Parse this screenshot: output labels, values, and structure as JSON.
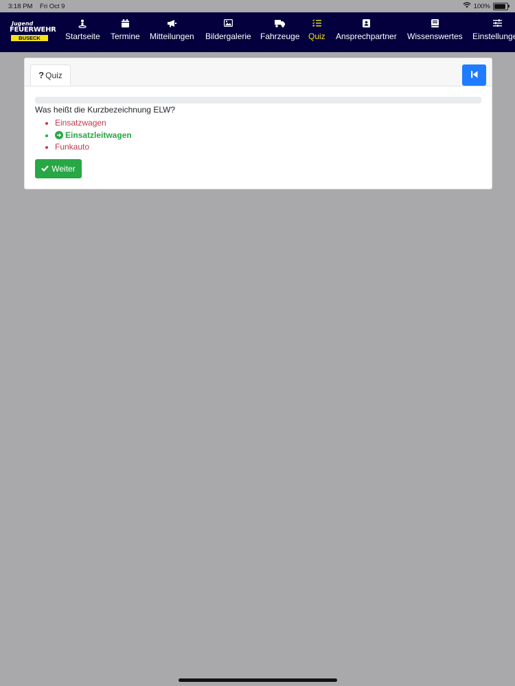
{
  "status_bar": {
    "time": "3:18 PM",
    "date": "Fri Oct 9",
    "battery": "100%",
    "battery_level": 1.0
  },
  "logo": {
    "line1": "Jugend",
    "line2": "FEUERWEHR",
    "line3": "BUSECK"
  },
  "nav": {
    "items": [
      {
        "label": "Startseite",
        "icon": "person-icon"
      },
      {
        "label": "Termine",
        "icon": "calendar-icon"
      },
      {
        "label": "Mitteilungen",
        "icon": "megaphone-icon"
      },
      {
        "label": "Bildergalerie",
        "icon": "image-icon"
      },
      {
        "label": "Fahrzeuge",
        "icon": "truck-icon"
      },
      {
        "label": "Quiz",
        "icon": "list-check-icon",
        "active": true
      },
      {
        "label": "Ansprechpartner",
        "icon": "contact-icon"
      },
      {
        "label": "Wissenswertes",
        "icon": "book-icon"
      },
      {
        "label": "Einstellungen",
        "icon": "sliders-icon"
      }
    ],
    "active_color": "#f4e11a",
    "background": "#03003d"
  },
  "quiz": {
    "tab_label": "Quiz",
    "progress": 0,
    "question": "Was heißt die Kurzbezeichnung ELW?",
    "answers": [
      {
        "label": "Einsatzwagen",
        "correct": false
      },
      {
        "label": "Einsatzleitwagen",
        "correct": true
      },
      {
        "label": "Funkauto",
        "correct": false
      }
    ],
    "next_label": "Weiter",
    "colors": {
      "correct": "#28a745",
      "wrong": "#c2384b",
      "primary": "#1f7bff"
    }
  }
}
